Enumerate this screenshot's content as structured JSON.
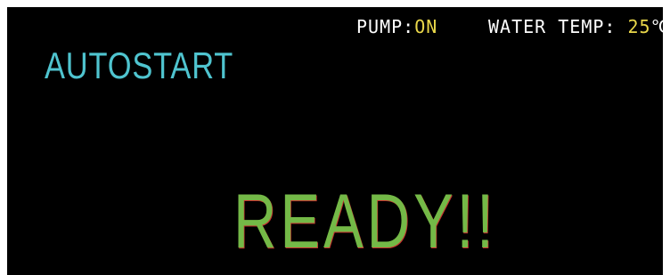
{
  "status_bar": {
    "pump_label": "PUMP:",
    "pump_value": "ON",
    "water_temp_label": "WATER TEMP:",
    "water_temp_value": "25",
    "water_temp_unit": "℃"
  },
  "mode": {
    "title": "AUTOSTART"
  },
  "message": {
    "status": "READY!!"
  },
  "colors": {
    "background": "#000000",
    "status_text": "#ffffff",
    "status_value": "#e9d74a",
    "mode_title": "#4fc4cf",
    "ready_text": "#74b947",
    "ready_outline": "#c93030"
  }
}
